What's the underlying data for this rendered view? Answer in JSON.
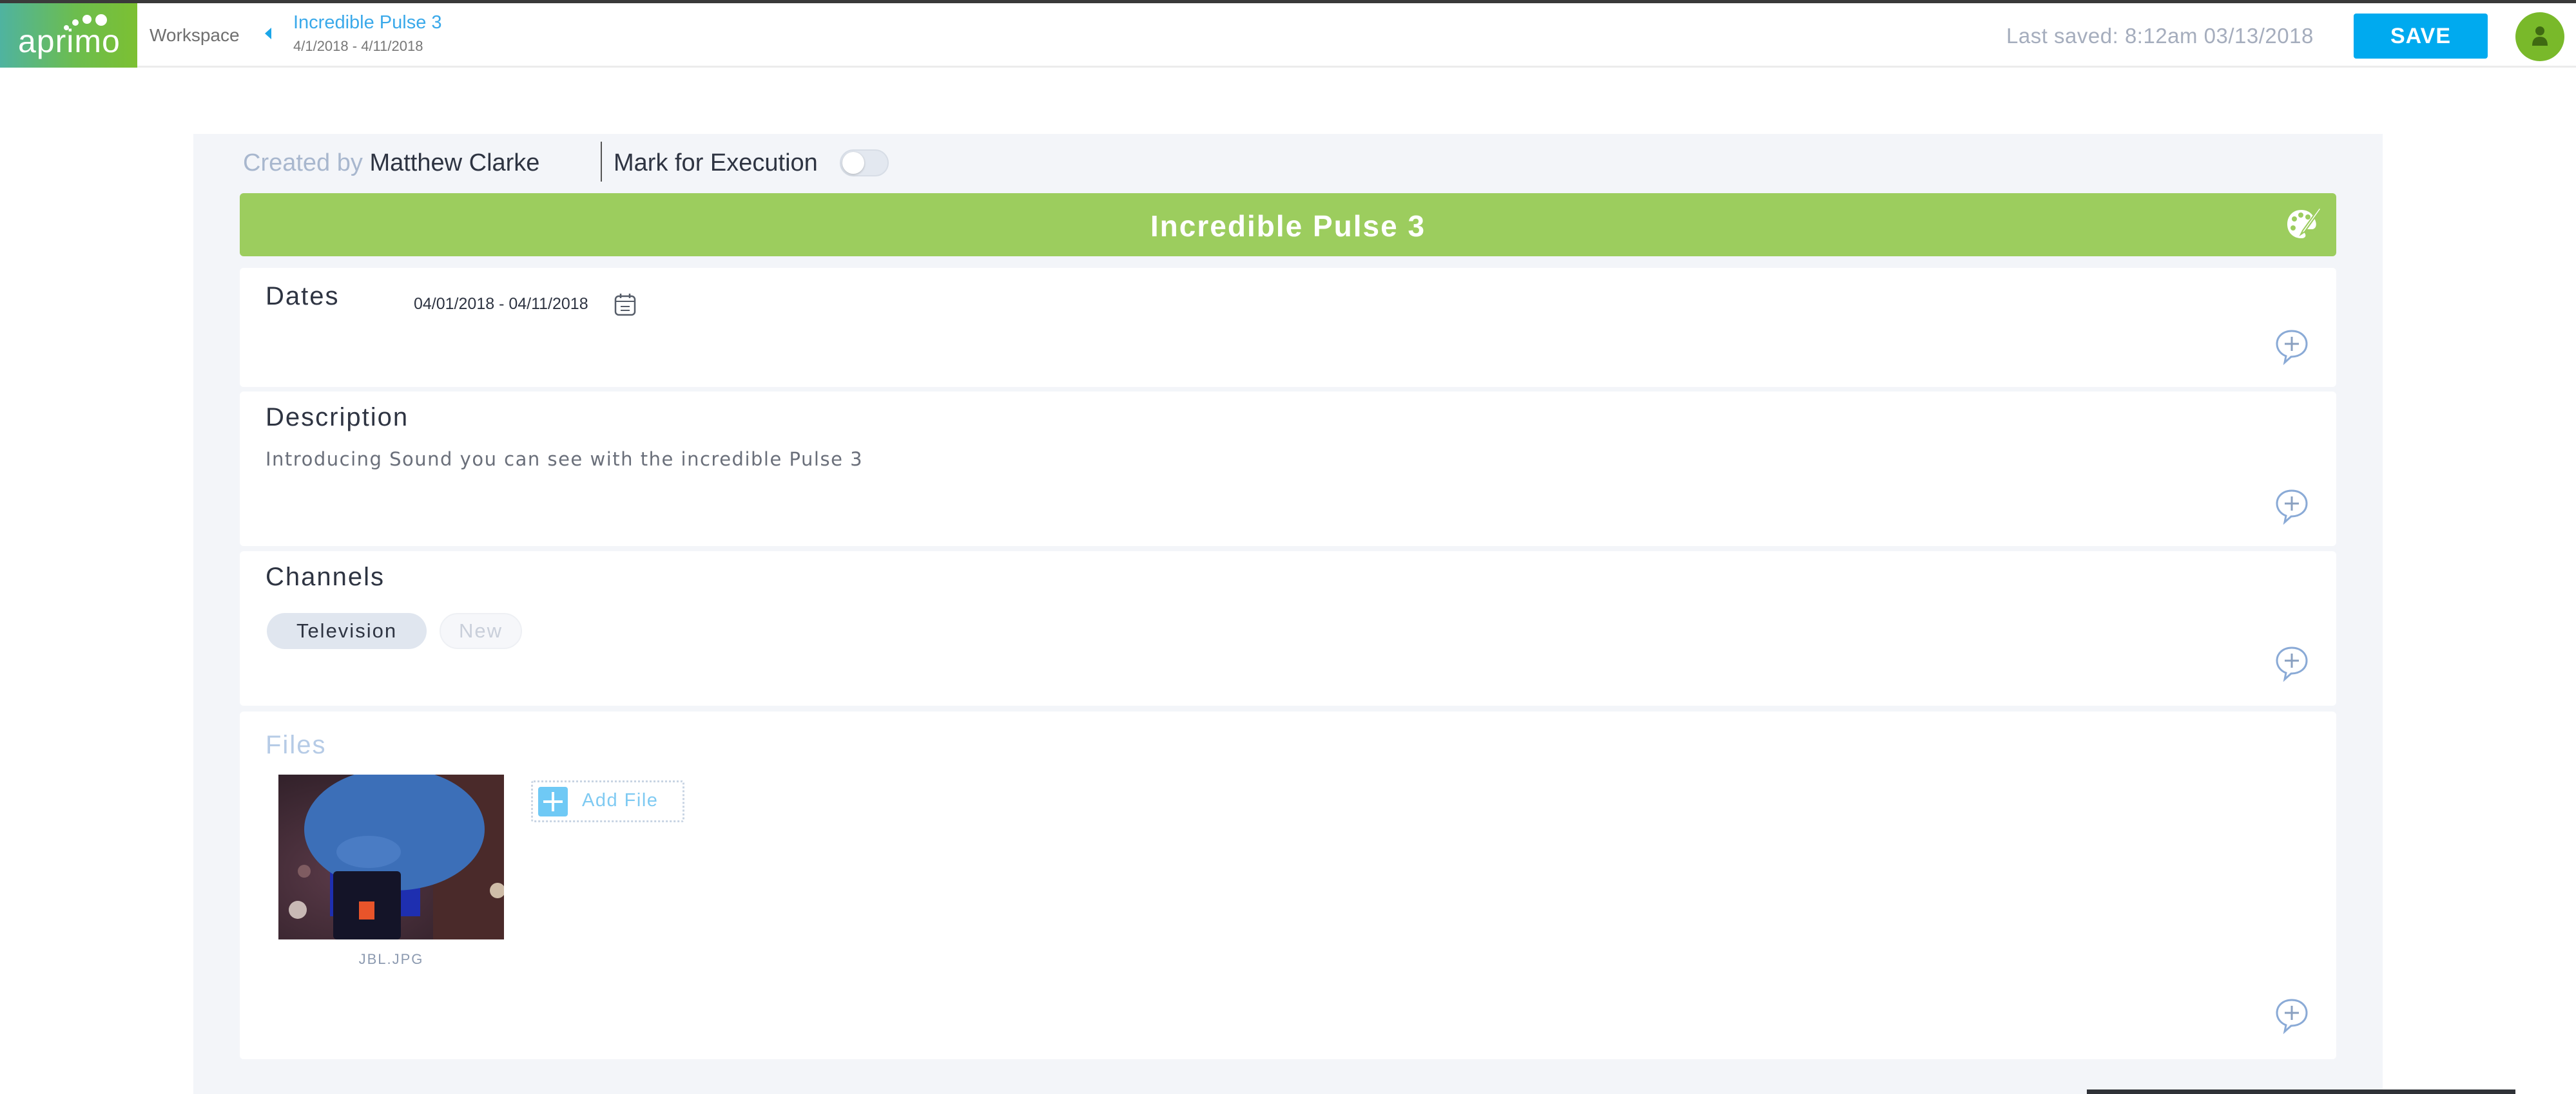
{
  "app": {
    "logo_text": "aprimo"
  },
  "header": {
    "breadcrumb_root": "Workspace",
    "breadcrumb_title": "Incredible Pulse 3",
    "breadcrumb_dates": "4/1/2018 - 4/11/2018",
    "last_saved": "Last saved: 8:12am 03/13/2018",
    "save_label": "SAVE",
    "icons": {
      "back": "caret-left-icon",
      "avatar": "user-icon"
    }
  },
  "meta": {
    "created_by_label": "Created by",
    "created_by_name": "Matthew Clarke",
    "mark_for_execution_label": "Mark for Execution",
    "mark_for_execution_on": false
  },
  "title_bar": {
    "title": "Incredible Pulse 3",
    "icon": "palette-icon",
    "color": "#9ccd5e"
  },
  "sections": {
    "dates": {
      "label": "Dates",
      "value": "04/01/2018 -  04/11/2018",
      "icon": "calendar-icon"
    },
    "description": {
      "label": "Description",
      "value": "Introducing Sound you can see with the incredible Pulse 3"
    },
    "channels": {
      "label": "Channels",
      "chips": [
        "Television"
      ],
      "new_placeholder": "New"
    },
    "files": {
      "label": "Files",
      "items": [
        {
          "name": "JBL.JPG"
        }
      ],
      "add_label": "Add File"
    },
    "comment_icon": "add-comment-icon"
  },
  "colors": {
    "accent": "#00aaef",
    "brand_green": "#79b92a",
    "panel_bg": "#f3f5f9"
  }
}
